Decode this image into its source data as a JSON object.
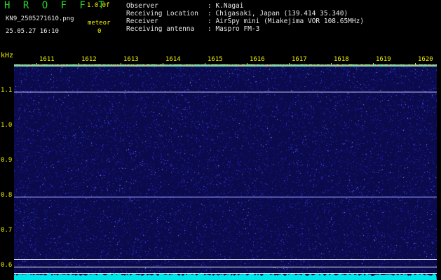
{
  "header": {
    "app_name": "H R O F F T",
    "version": "1.0.0f",
    "filename": "KN9_2505271610.png",
    "timestamp": "25.05.27 16:10",
    "meteor_label": "meteor",
    "meteor_count": "0"
  },
  "info": {
    "observer": {
      "label": "Observer",
      "value": ": K.Nagai"
    },
    "location": {
      "label": "Receiving Location",
      "value": ": Chigasaki, Japan (139.414 35.340)"
    },
    "receiver": {
      "label": "Receiver",
      "value": ": AirSpy mini (Miakejima VOR 108.65MHz)"
    },
    "antenna": {
      "label": "Receiving antenna",
      "value": ": Maspro FM-3"
    }
  },
  "plot": {
    "y_unit": "kHz",
    "y_ticks": [
      "1.1",
      "1.0",
      "0.9",
      "0.8",
      "0.7",
      "0.6"
    ],
    "x_ticks": [
      "1611",
      "1612",
      "1613",
      "1614",
      "1615",
      "1616",
      "1617",
      "1618",
      "1619",
      "1620"
    ],
    "colors": {
      "background": "#0a0a4c",
      "tick": "#f2f200",
      "trace": "#00e5e5",
      "line": "#ffffff"
    }
  }
}
